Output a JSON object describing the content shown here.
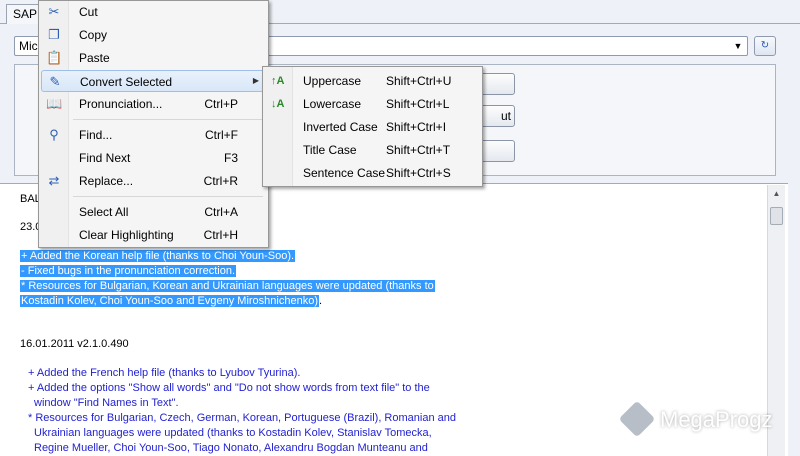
{
  "tab": {
    "label": "SAPI"
  },
  "voice_select": {
    "value": "Mic"
  },
  "control_buttons": [
    {
      "label": ""
    },
    {
      "label": "ut"
    },
    {
      "label": ""
    }
  ],
  "context_menu": {
    "items": [
      {
        "icon": "cut-icon",
        "label": "Cut",
        "shortcut": ""
      },
      {
        "icon": "copy-icon",
        "label": "Copy",
        "shortcut": ""
      },
      {
        "icon": "paste-icon",
        "label": "Paste",
        "shortcut": ""
      },
      {
        "icon": "convert-icon",
        "label": "Convert Selected",
        "shortcut": ""
      },
      {
        "icon": "pronunciation-icon",
        "label": "Pronunciation...",
        "shortcut": "Ctrl+P"
      },
      {
        "icon": "find-icon",
        "label": "Find...",
        "shortcut": "Ctrl+F"
      },
      {
        "icon": "",
        "label": "Find Next",
        "shortcut": "F3"
      },
      {
        "icon": "replace-icon",
        "label": "Replace...",
        "shortcut": "Ctrl+R"
      },
      {
        "icon": "",
        "label": "Select All",
        "shortcut": "Ctrl+A"
      },
      {
        "icon": "",
        "label": "Clear Highlighting",
        "shortcut": "Ctrl+H"
      }
    ]
  },
  "submenu": {
    "items": [
      {
        "icon": "uppercase-icon",
        "label": "Uppercase",
        "shortcut": "Shift+Ctrl+U"
      },
      {
        "icon": "lowercase-icon",
        "label": "Lowercase",
        "shortcut": "Shift+Ctrl+L"
      },
      {
        "icon": "",
        "label": "Inverted Case",
        "shortcut": "Shift+Ctrl+I"
      },
      {
        "icon": "",
        "label": "Title Case",
        "shortcut": "Shift+Ctrl+T"
      },
      {
        "icon": "",
        "label": "Sentence Case",
        "shortcut": "Shift+Ctrl+S"
      }
    ]
  },
  "document": {
    "line_bal": "BAL",
    "line_date1": "23.0",
    "sel1": "+ Added the Korean help file (thanks to Choi Youn-Soo).",
    "sel2": "- Fixed bugs in the pronunciation correction.",
    "sel3": "* Resources for Bulgarian, Korean and Ukrainian languages were updated (thanks to",
    "sel4": "Kostadin Kolev, Choi Youn-Soo and Evgeny Miroshnichenko)",
    "sel4_tail": ".",
    "version_line": "16.01.2011     v2.1.0.490",
    "b1": "+ Added the French help file (thanks to Lyubov Tyurina).",
    "b2": "+ Added the options \"Show all words\" and \"Do not show words from text file\" to the",
    "b3": "window \"Find Names in Text\".",
    "b4": "* Resources for Bulgarian, Czech, German, Korean, Portuguese (Brazil), Romanian and",
    "b5": "Ukrainian languages were updated (thanks to Kostadin Kolev, Stanislav Tomecka,",
    "b6": "Regine Mueller, Choi Youn-Soo, Tiago Nonato, Alexandru Bogdan Munteanu and"
  },
  "watermark": {
    "text": "MegaProgz"
  }
}
